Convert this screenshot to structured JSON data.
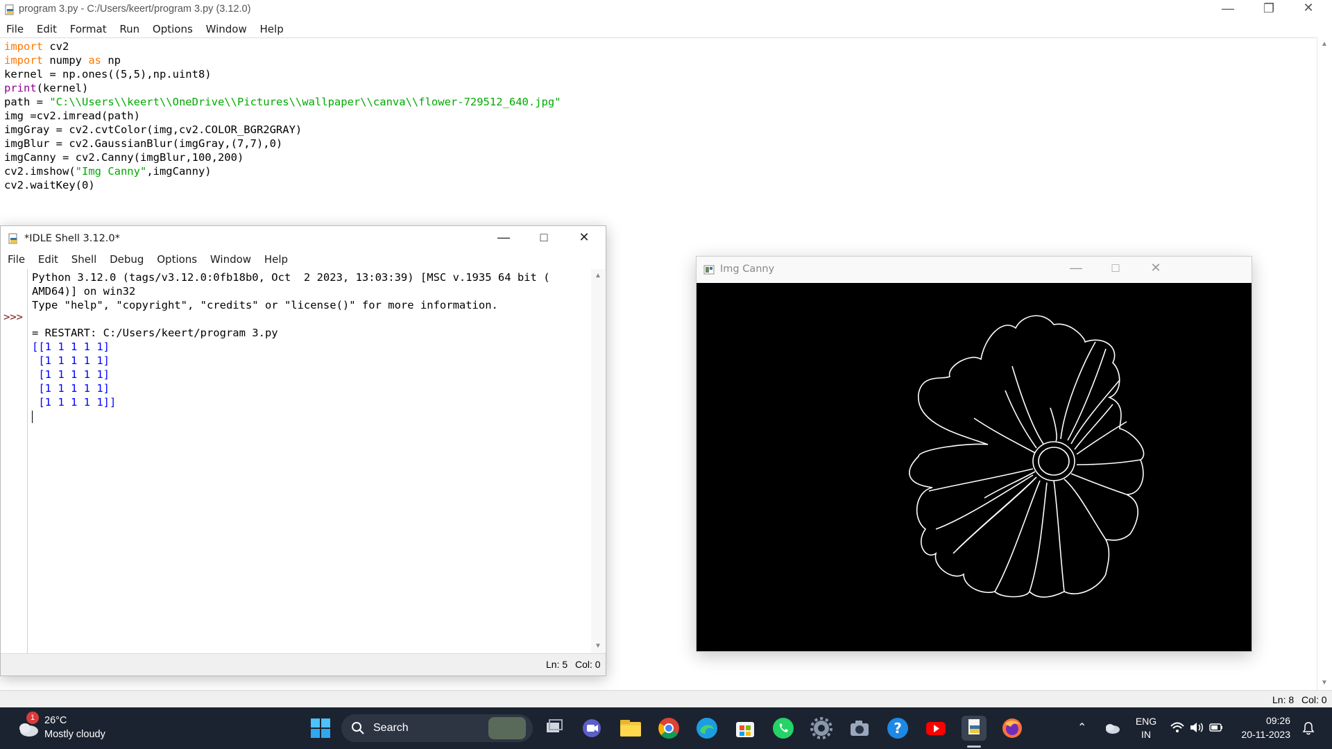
{
  "editor_window": {
    "title": "program 3.py - C:/Users/keert/program 3.py (3.12.0)",
    "menu": [
      "File",
      "Edit",
      "Format",
      "Run",
      "Options",
      "Window",
      "Help"
    ],
    "code_lines": [
      "import cv2",
      "import numpy as np",
      "kernel = np.ones((5,5),np.uint8)",
      "print(kernel)",
      "path = \"C:\\\\Users\\\\keert\\\\OneDrive\\\\Pictures\\\\wallpaper\\\\canva\\\\flower-729512_640.jpg\"",
      "img =cv2.imread(path)",
      "imgGray = cv2.cvtColor(img,cv2.COLOR_BGR2GRAY)",
      "imgBlur = cv2.GaussianBlur(imgGray,(7,7),0)",
      "imgCanny = cv2.Canny(imgBlur,100,200)",
      "cv2.imshow(\"Img Canny\",imgCanny)",
      "cv2.waitKey(0)"
    ],
    "status": {
      "line": "Ln: 8",
      "col": "Col: 0"
    }
  },
  "shell_window": {
    "title": "*IDLE Shell 3.12.0*",
    "menu": [
      "File",
      "Edit",
      "Shell",
      "Debug",
      "Options",
      "Window",
      "Help"
    ],
    "prompt": ">>>",
    "lines": [
      "Python 3.12.0 (tags/v3.12.0:0fb18b0, Oct  2 2023, 13:03:39) [MSC v.1935 64 bit (",
      "AMD64)] on win32",
      "Type \"help\", \"copyright\", \"credits\" or \"license()\" for more information."
    ],
    "restart_line": "= RESTART: C:/Users/keert/program 3.py",
    "output_lines": [
      "[[1 1 1 1 1]",
      " [1 1 1 1 1]",
      " [1 1 1 1 1]",
      " [1 1 1 1 1]",
      " [1 1 1 1 1]]"
    ],
    "status": {
      "line": "Ln: 5",
      "col": "Col: 0"
    }
  },
  "canny_window": {
    "title": "Img Canny"
  },
  "taskbar": {
    "weather": {
      "temp": "26°C",
      "condition": "Mostly cloudy",
      "badge": "1"
    },
    "search_label": "Search",
    "language": {
      "line1": "ENG",
      "line2": "IN"
    },
    "clock": {
      "time": "09:26",
      "date": "20-11-2023"
    },
    "apps": [
      "windows-start",
      "search",
      "task-view",
      "meet",
      "file-explorer",
      "chrome",
      "edge",
      "microsoft-store",
      "whatsapp",
      "settings",
      "camera",
      "help",
      "youtube",
      "idle",
      "firefox"
    ]
  },
  "colors": {
    "keyword": "#ff7700",
    "builtin": "#900090",
    "string": "#00aa00",
    "shell_output": "#0000ff",
    "taskbar_bg": "#1c2330"
  }
}
